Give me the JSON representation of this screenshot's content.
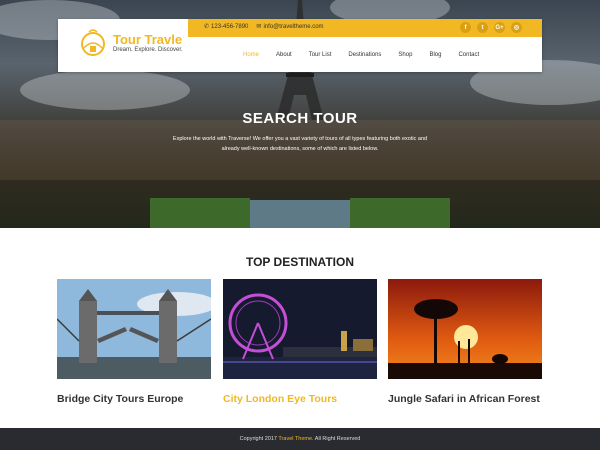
{
  "header": {
    "phone": "123-456-7890",
    "email": "info@traveltheme.com",
    "socials": [
      {
        "icon": "facebook-icon",
        "glyph": "f"
      },
      {
        "icon": "twitter-icon",
        "glyph": "t"
      },
      {
        "icon": "google-plus-icon",
        "glyph": "G+"
      },
      {
        "icon": "dribbble-icon",
        "glyph": "◎"
      }
    ],
    "logo_title": "Tour Travle",
    "logo_tagline": "Dream. Explore. Discover.",
    "nav": [
      "Home",
      "About",
      "Tour List",
      "Destinations",
      "Shop",
      "Blog",
      "Contact"
    ],
    "active_nav": "Home",
    "accent_color": "#f1b823"
  },
  "hero": {
    "title": "SEARCH TOUR",
    "subtitle": "Explore the world with Traverse! We offer you a vast variety of tours of all types featuring both exotic and already well-known destinations, some of which are listed below."
  },
  "destinations": {
    "heading": "TOP DESTINATION",
    "cards": [
      {
        "title": "Bridge City Tours Europe",
        "highlight": false
      },
      {
        "title": "City London Eye Tours",
        "highlight": true
      },
      {
        "title": "Jungle Safari in African Forest",
        "highlight": false
      }
    ]
  },
  "footer": {
    "prefix": "Copyright 2017",
    "brand": "Travel Theme.",
    "suffix": "All Right Reserved"
  }
}
